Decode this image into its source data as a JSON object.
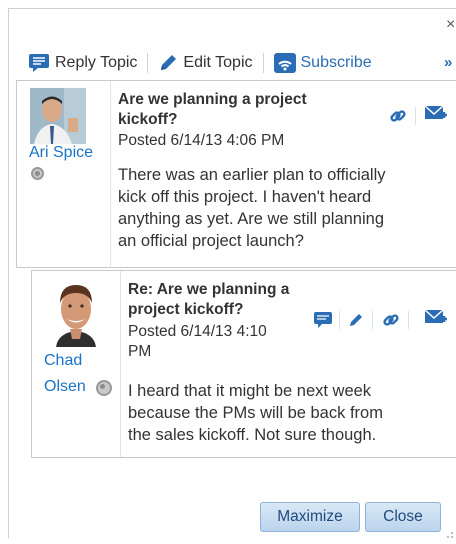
{
  "toolbar": {
    "reply_label": "Reply Topic",
    "edit_label": "Edit Topic",
    "subscribe_label": "Subscribe",
    "more_label": "»",
    "close_label": "×"
  },
  "posts": [
    {
      "author": "Ari Spice",
      "title_line1": "Are we planning a project",
      "title_line2": "kickoff?",
      "posted": "Posted 6/14/13 4:06 PM",
      "body": [
        "There was an earlier plan to officially",
        "kick off this project. I haven't heard",
        "anything as yet. Are we still planning",
        "an official project launch?"
      ]
    },
    {
      "author_line1": "Chad",
      "author_line2": "Olsen",
      "title_line1": "Re: Are we planning a",
      "title_line2": "project kickoff?",
      "posted_line1": "Posted 6/14/13 4:10",
      "posted_line2": "PM",
      "body": [
        "I heard that it might be next week",
        "because the PMs will be back from",
        "the sales kickoff. Not sure though."
      ]
    }
  ],
  "footer": {
    "maximize_label": "Maximize",
    "close_label": "Close"
  },
  "colors": {
    "link": "#1a73c7",
    "icon_blue": "#2a6db5",
    "button_border": "#8fb2d6"
  }
}
